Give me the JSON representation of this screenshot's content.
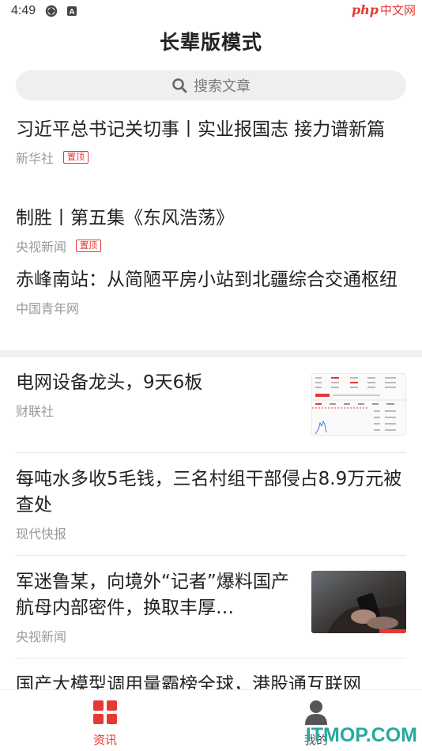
{
  "status_bar": {
    "time": "4:49",
    "watermark_logo": "php",
    "watermark_text": "中文网"
  },
  "header": {
    "title": "长辈版模式"
  },
  "search": {
    "placeholder": "搜索文章"
  },
  "pinned": [
    {
      "title": "习近平总书记关切事丨实业报国志 接力谱新篇",
      "source": "新华社",
      "tag": "置顶"
    },
    {
      "title": "制胜丨第五集《东风浩荡》",
      "source": "央视新闻",
      "tag": "置顶"
    },
    {
      "title": "赤峰南站：从简陋平房小站到北疆综合交通枢纽",
      "source": "中国青年网"
    }
  ],
  "news": [
    {
      "title": "电网设备龙头，9天6板",
      "source": "财联社",
      "thumb": "stock-chart-thumbnail"
    },
    {
      "title": "每吨水多收5毛钱，三名村组干部侵占8.9万元被查处",
      "source": "现代快报"
    },
    {
      "title": "军迷鲁某，向境外“记者”爆料国产航母内部密件，换取丰厚…",
      "source": "央视新闻",
      "thumb": "phone-in-hand-thumbnail"
    },
    {
      "title": "国产大模型调用量霸榜全球，港股通互联网"
    }
  ],
  "bottom_nav": {
    "news_label": "资讯",
    "mine_label": "我的"
  },
  "footer_watermark": "ITMOP.COM",
  "colors": {
    "accent": "#e53935",
    "watermark": "#27a9a0"
  }
}
